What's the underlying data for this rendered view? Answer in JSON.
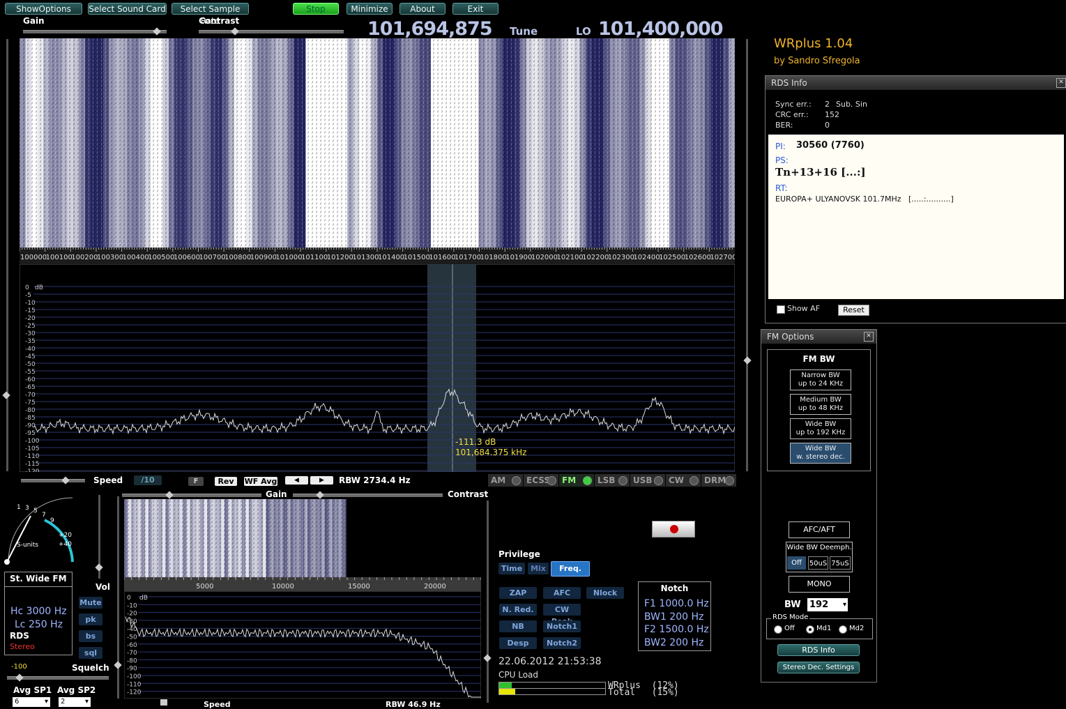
{
  "toolbar": {
    "show_options": "ShowOptions",
    "select_sound_card": "Select Sound Card",
    "select_sample_rate": "Select Sample Rate",
    "stop": "Stop",
    "minimize": "Minimize",
    "about": "About",
    "exit": "Exit"
  },
  "top_sliders": {
    "gain": "Gain",
    "contrast": "Contrast",
    "gain_level": 0.93,
    "contrast_level": 0.25
  },
  "tune": {
    "freq": "101,694,875",
    "tune_label": "Tune",
    "lo_label": "LO",
    "lo_freq": "101,400,000"
  },
  "app": {
    "title": "WRplus 1.04",
    "author": "by Sandro Sfregola"
  },
  "spectrum": {
    "freq_labels": [
      "100000",
      "100100",
      "100200",
      "100300",
      "100400",
      "100500",
      "100600",
      "100700",
      "100800",
      "100900",
      "101000",
      "101100",
      "101200",
      "101300",
      "101400",
      "101500",
      "101600",
      "101700",
      "101800",
      "101900",
      "102000",
      "102100",
      "102200",
      "102300",
      "102400",
      "102500",
      "102600",
      "102700"
    ],
    "db_labels": [
      "0",
      "-5",
      "-10",
      "-15",
      "-20",
      "-25",
      "-30",
      "-35",
      "-40",
      "-45",
      "-50",
      "-55",
      "-60",
      "-65",
      "-70",
      "-75",
      "-80",
      "-85",
      "-90",
      "-95",
      "-100",
      "-105",
      "-110",
      "-115",
      "-120"
    ],
    "db_unit": "dB",
    "cursor_db": "-111.3 dB",
    "cursor_freq": "101,684.375 kHz"
  },
  "controls_row": {
    "speed": "Speed",
    "div": "/10",
    "f": "F",
    "rev": "Rev",
    "wf_avg": "WF Avg",
    "rbw": "RBW 2734.4 Hz",
    "speed_level": 0.7
  },
  "modes": [
    {
      "label": "AM",
      "active": false
    },
    {
      "label": "ECSS",
      "active": false
    },
    {
      "label": "FM",
      "active": true
    },
    {
      "label": "LSB",
      "active": false
    },
    {
      "label": "USB",
      "active": false
    },
    {
      "label": "CW",
      "active": false
    },
    {
      "label": "DRM",
      "active": false
    }
  ],
  "smeter": {
    "ticks": [
      "1",
      "3",
      "5",
      "7",
      "9",
      "+20",
      "+40"
    ],
    "label": "S-units"
  },
  "info_box": {
    "mode": "St. Wide FM",
    "hc": "Hc  3000 Hz",
    "lc": "Lc   250 Hz",
    "rds": "RDS",
    "stereo": "Stereo"
  },
  "vol": {
    "label": "Vol",
    "mute": "Mute",
    "pk": "pk",
    "bs": "bs",
    "sql": "sql"
  },
  "squelch": {
    "value": "-100",
    "label": "Squelch",
    "level": 0.12
  },
  "avg": {
    "sp1_label": "Avg SP1",
    "sp2_label": "Avg SP2",
    "sp1_value": "6",
    "sp2_value": "2"
  },
  "audio": {
    "gain": "Gain",
    "contrast": "Contrast",
    "freq_labels": [
      "5000",
      "10000",
      "15000",
      "20000"
    ],
    "db_labels": [
      "0",
      "-10",
      "-20",
      "-30",
      "-40",
      "-50",
      "-60",
      "-70",
      "-80",
      "-90",
      "-100",
      "-110",
      "-120"
    ],
    "db_unit": "dB",
    "speed": "Speed",
    "rbw": "RBW 46.9 Hz"
  },
  "privilege": {
    "label": "Privilege",
    "time": "Time",
    "mix": "Mix",
    "freq": "Freq."
  },
  "dsp": {
    "zap": "ZAP",
    "afc": "AFC",
    "nlock": "Nlock",
    "nred": "N. Red.",
    "cwpeak": "CW Peak",
    "nb": "NB",
    "notch1": "Notch1",
    "desp": "Desp",
    "notch2": "Notch2"
  },
  "notch": {
    "title": "Notch",
    "f1": "F1 1000.0 Hz",
    "bw1": "BW1  200 Hz",
    "f2": "F2 1500.0 Hz",
    "bw2": "BW2  200 Hz"
  },
  "status": {
    "datetime": "22.06.2012 21:53:38",
    "cpu_label": "CPU Load",
    "wrplus": "WRplus  (12%)",
    "total": "Total   (15%)",
    "wrplus_load": 0.12,
    "total_load": 0.15
  },
  "rds": {
    "title": "RDS Info",
    "sync_err_label": "Sync err.:",
    "sync_err": "2",
    "sub": "Sub. Sin",
    "crc_err_label": "CRC err.:",
    "crc_err": "152",
    "ber_label": "BER:",
    "ber": "0",
    "pi_label": "PI:",
    "pi": "30560 (7760)",
    "ps_label": "PS:",
    "ps": "Tn+13+16 [...:]",
    "rt_label": "RT:",
    "rt": "EUROPA+ ULYANOVSK 101.7MHz   [.....:..........]",
    "show_af": "Show AF",
    "reset": "Reset"
  },
  "fm_options": {
    "title": "FM Options",
    "fm_bw": "FM BW",
    "narrow1": "Narrow BW",
    "narrow2": "up to 24 KHz",
    "medium1": "Medium BW",
    "medium2": "up to 48 KHz",
    "wide1": "Wide BW",
    "wide2": "up to 192 KHz",
    "wst1": "Wide BW",
    "wst2": "w. stereo dec.",
    "afc": "AFC/AFT",
    "deemph": "Wide BW Deemph.",
    "off": "Off",
    "us50": "50uS",
    "us75": "75uS",
    "mono": "MONO",
    "bw_label": "BW",
    "bw_value": "192",
    "rds_mode": "RDS Mode",
    "rds_off": "Off",
    "rds_md1": "Md1",
    "rds_md2": "Md2",
    "rds_info_btn": "RDS Info",
    "stereo_settings_btn": "Stereo Dec. Settings"
  }
}
